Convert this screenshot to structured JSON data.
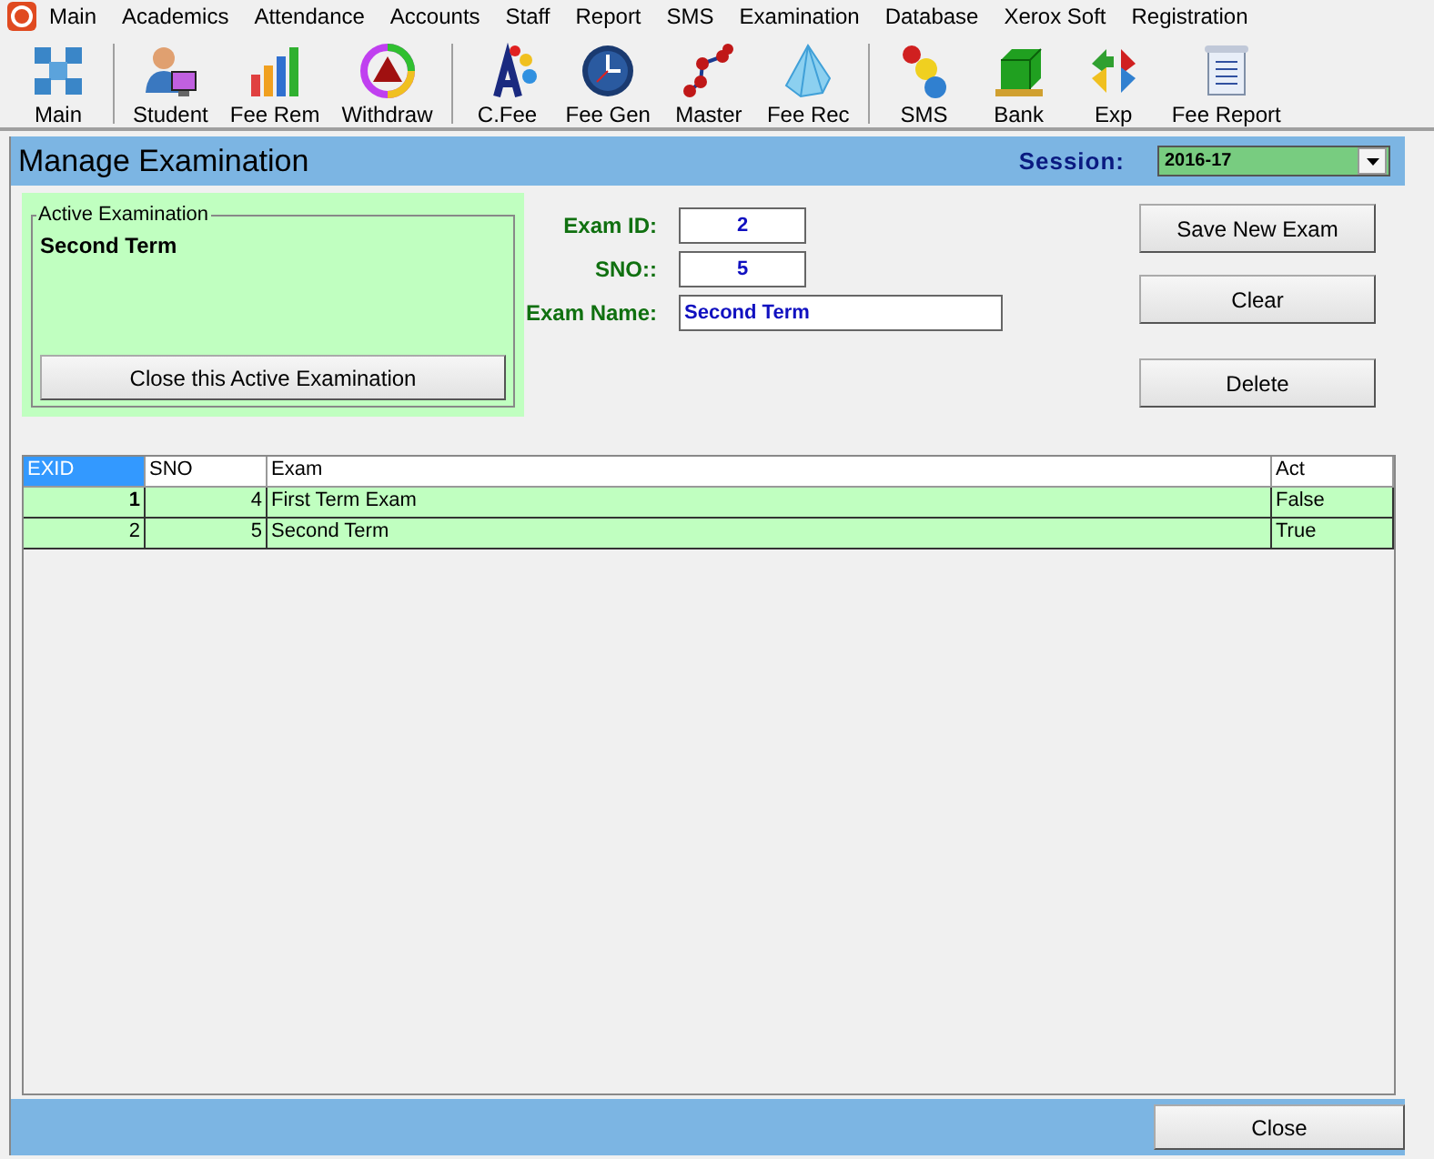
{
  "menu": [
    "Main",
    "Academics",
    "Attendance",
    "Accounts",
    "Staff",
    "Report",
    "SMS",
    "Examination",
    "Database",
    "Xerox Soft",
    "Registration"
  ],
  "toolbar_groups": [
    [
      "Main"
    ],
    [
      "Student",
      "Fee Rem",
      "Withdraw"
    ],
    [
      "C.Fee",
      "Fee Gen",
      "Master",
      "Fee Rec"
    ],
    [
      "SMS",
      "Bank",
      "Exp",
      "Fee Report"
    ]
  ],
  "header": {
    "title": "Manage Examination",
    "session_label": "Session:",
    "session_value": "2016-17"
  },
  "active_exam": {
    "legend": "Active Examination",
    "name": "Second Term",
    "button": "Close this Active Examination"
  },
  "fields": [
    {
      "label": "Exam ID:",
      "value": "2",
      "kind": "number"
    },
    {
      "label": "SNO::",
      "value": "5",
      "kind": "number"
    },
    {
      "label": "Exam Name:",
      "value": "Second Term",
      "kind": "text"
    }
  ],
  "buttons": [
    "Save New Exam",
    "Clear",
    "Delete"
  ],
  "table": {
    "columns": [
      {
        "label": "EXID",
        "selected": true
      },
      {
        "label": "SNO",
        "selected": false
      },
      {
        "label": "Exam",
        "selected": false
      },
      {
        "label": "Act",
        "selected": false
      }
    ],
    "rows": [
      {
        "cells": [
          "1",
          "4",
          "First Term Exam",
          "False"
        ],
        "current": true
      },
      {
        "cells": [
          "2",
          "5",
          "Second Term",
          "True"
        ],
        "current": false
      }
    ]
  },
  "footer": {
    "button": "Close"
  }
}
